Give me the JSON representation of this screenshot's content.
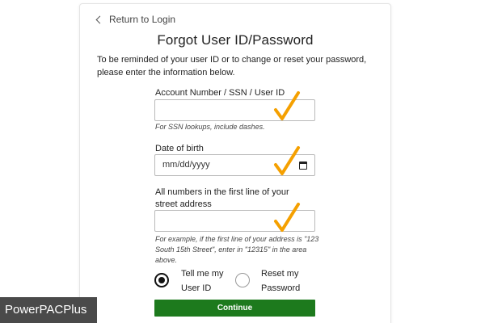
{
  "back_link": {
    "label": "Return to Login"
  },
  "page_title": "Forgot User ID/Password",
  "intro_text": "To be reminded of your user ID or to change or reset your password, please enter the information below.",
  "fields": {
    "account": {
      "label": "Account Number / SSN / User ID",
      "value": "",
      "hint": "For SSN lookups, include dashes."
    },
    "dob": {
      "label": "Date of birth",
      "placeholder": "mm/dd/yyyy",
      "icon": "calendar-icon"
    },
    "street": {
      "label": "All numbers in the first line of your street address",
      "value": "",
      "hint": "For example, if the first line of your address is \"123 South 15th Street\", enter in \"12315\" in the area above."
    }
  },
  "options": [
    {
      "label": "Tell me my User ID",
      "selected": true
    },
    {
      "label": "Reset my Password",
      "selected": false
    }
  ],
  "continue_label": "Continue",
  "watermark": "PowerPACPlus",
  "colors": {
    "accent_green": "#1d7a1d",
    "checkmark_orange": "#f5a000",
    "watermark_bg": "#4a4a4a"
  }
}
